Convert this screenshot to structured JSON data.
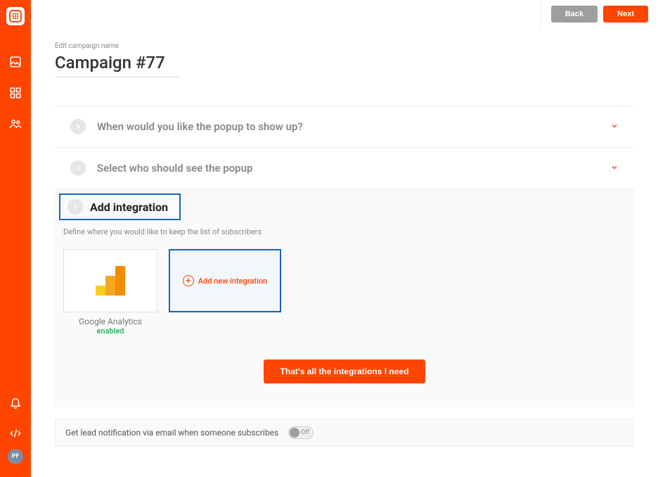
{
  "sidebar": {
    "avatar_initials": "PF"
  },
  "topbar": {
    "back_label": "Back",
    "next_label": "Next"
  },
  "campaign": {
    "edit_label": "Edit campaign name",
    "name": "Campaign #77"
  },
  "sections": {
    "when": {
      "title": "When would you like the popup to show up?"
    },
    "who": {
      "title": "Select who should see the popup"
    },
    "integration": {
      "title": "Add integration",
      "subtitle": "Define where you would like to keep the list of subscribers",
      "cards": [
        {
          "name": "Google Analytics",
          "status": "enabled"
        }
      ],
      "add_label": "Add new integration",
      "done_label": "That's all the integrations I need"
    }
  },
  "notification": {
    "text": "Get lead notification via email when someone subscribes",
    "toggle_label": "Off"
  }
}
